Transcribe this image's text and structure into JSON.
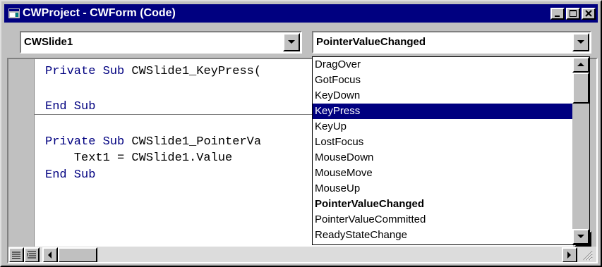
{
  "window": {
    "title": "CWProject - CWForm (Code)"
  },
  "object_combo": {
    "value": "CWSlide1"
  },
  "procedure_combo": {
    "value": "PointerValueChanged"
  },
  "code_lines": [
    {
      "kw": "Private Sub ",
      "rest": "CWSlide1_KeyPress("
    },
    {
      "kw": "End Sub",
      "rest": ""
    },
    {
      "kw": "Private Sub ",
      "rest": "CWSlide1_PointerVa"
    },
    {
      "kw": "",
      "rest": "    Text1 = CWSlide1.Value"
    },
    {
      "kw": "End Sub",
      "rest": ""
    }
  ],
  "procedure_list": {
    "items": [
      "DragOver",
      "GotFocus",
      "KeyDown",
      "KeyPress",
      "KeyUp",
      "LostFocus",
      "MouseDown",
      "MouseMove",
      "MouseUp",
      "PointerValueChanged",
      "PointerValueCommitted",
      "ReadyStateChange"
    ],
    "selected": "KeyPress",
    "bold": "PointerValueChanged"
  },
  "colors": {
    "title_bar": "#000080",
    "selection": "#000080",
    "keyword": "#000080",
    "face": "#c0c0c0"
  },
  "icons": [
    "app-icon",
    "minimize-icon",
    "maximize-icon",
    "close-icon",
    "dropdown-arrow-icon",
    "scroll-up-icon",
    "scroll-down-icon",
    "scroll-left-icon",
    "scroll-right-icon",
    "procedure-view-icon",
    "full-module-view-icon",
    "resize-grip-icon"
  ]
}
